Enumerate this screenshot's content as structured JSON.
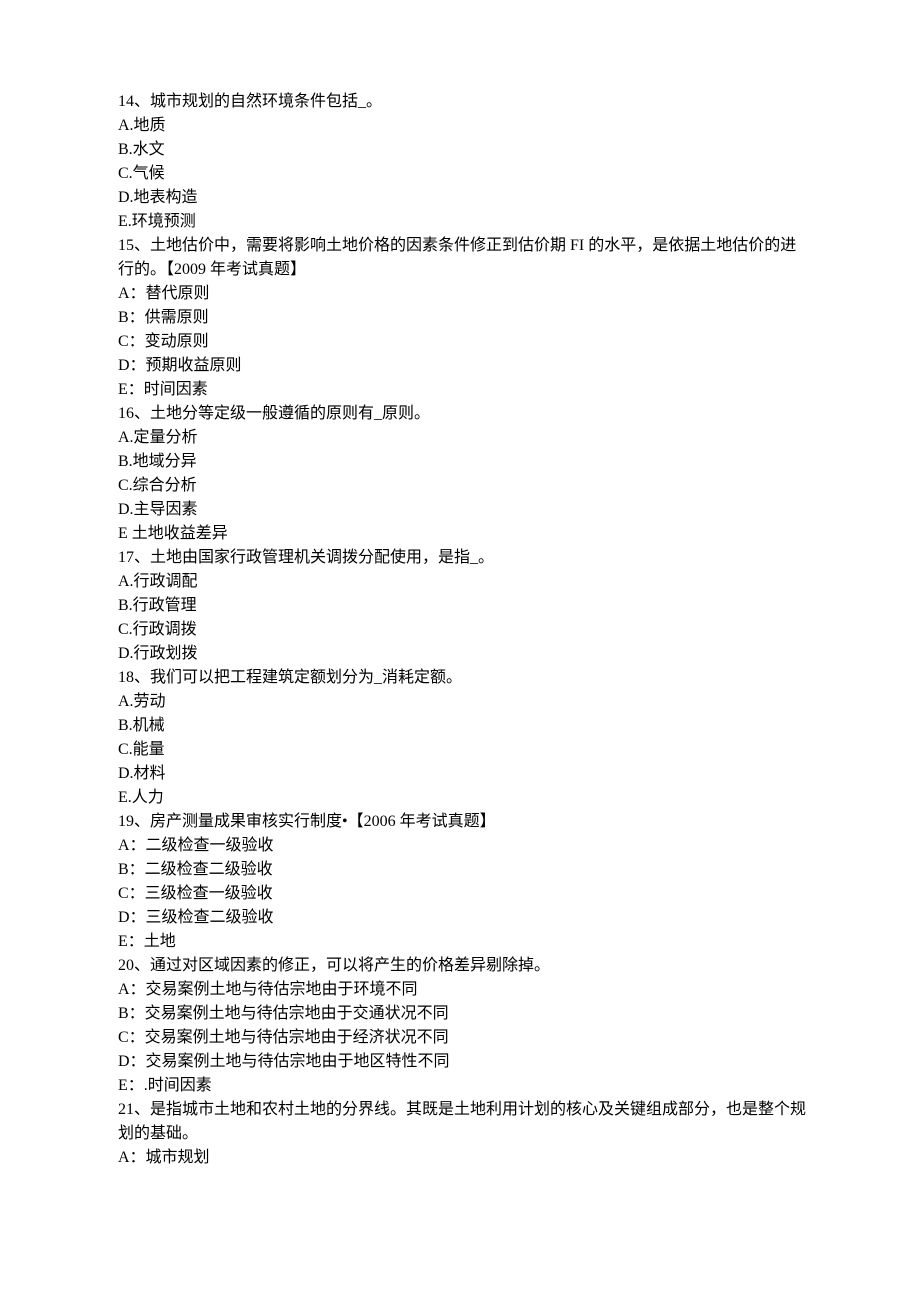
{
  "questions": [
    {
      "number": "14、",
      "stem": "城市规划的自然环境条件包括_。",
      "options": [
        "A.地质",
        "B.水文",
        "C.气候",
        "D.地表构造",
        "E.环境预测"
      ]
    },
    {
      "number": "15、",
      "stem": "土地估价中，需要将影响土地价格的因素条件修正到估价期 FI 的水平，是依据土地估价的进行的。【2009 年考试真题】",
      "options": [
        "A：替代原则",
        "B：供需原则",
        "C：变动原则",
        "D：预期收益原则",
        "E：时间因素"
      ]
    },
    {
      "number": "16、",
      "stem": "土地分等定级一般遵循的原则有_原则。",
      "options": [
        "A.定量分析",
        "B.地域分异",
        "C.综合分析",
        "D.主导因素",
        "E 土地收益差异"
      ]
    },
    {
      "number": "17、",
      "stem": "土地由国家行政管理机关调拨分配使用，是指_。",
      "options": [
        "A.行政调配",
        "B.行政管理",
        "C.行政调拨",
        "D.行政划拨"
      ]
    },
    {
      "number": "18、",
      "stem": "我们可以把工程建筑定额划分为_消耗定额。",
      "options": [
        "A.劳动",
        "B.机械",
        "C.能量",
        "D.材料",
        "E.人力"
      ]
    },
    {
      "number": "19、",
      "stem": "房产测量成果审核实行制度•【2006 年考试真题】",
      "options": [
        "A：二级检查一级验收",
        "B：二级检查二级验收",
        "C：三级检查一级验收",
        "D：三级检查二级验收",
        "E：土地"
      ]
    },
    {
      "number": "20、",
      "stem": "通过对区域因素的修正，可以将产生的价格差异剔除掉。",
      "options": [
        "A：交易案例土地与待估宗地由于环境不同",
        "B：交易案例土地与待估宗地由于交通状况不同",
        "C：交易案例土地与待估宗地由于经济状况不同",
        "D：交易案例土地与待估宗地由于地区特性不同",
        "E：.时间因素"
      ]
    },
    {
      "number": "21、",
      "stem": "是指城市土地和农村土地的分界线。其既是土地利用计划的核心及关键组成部分，也是整个规划的基础。",
      "options": [
        "A：城市规划"
      ]
    }
  ]
}
